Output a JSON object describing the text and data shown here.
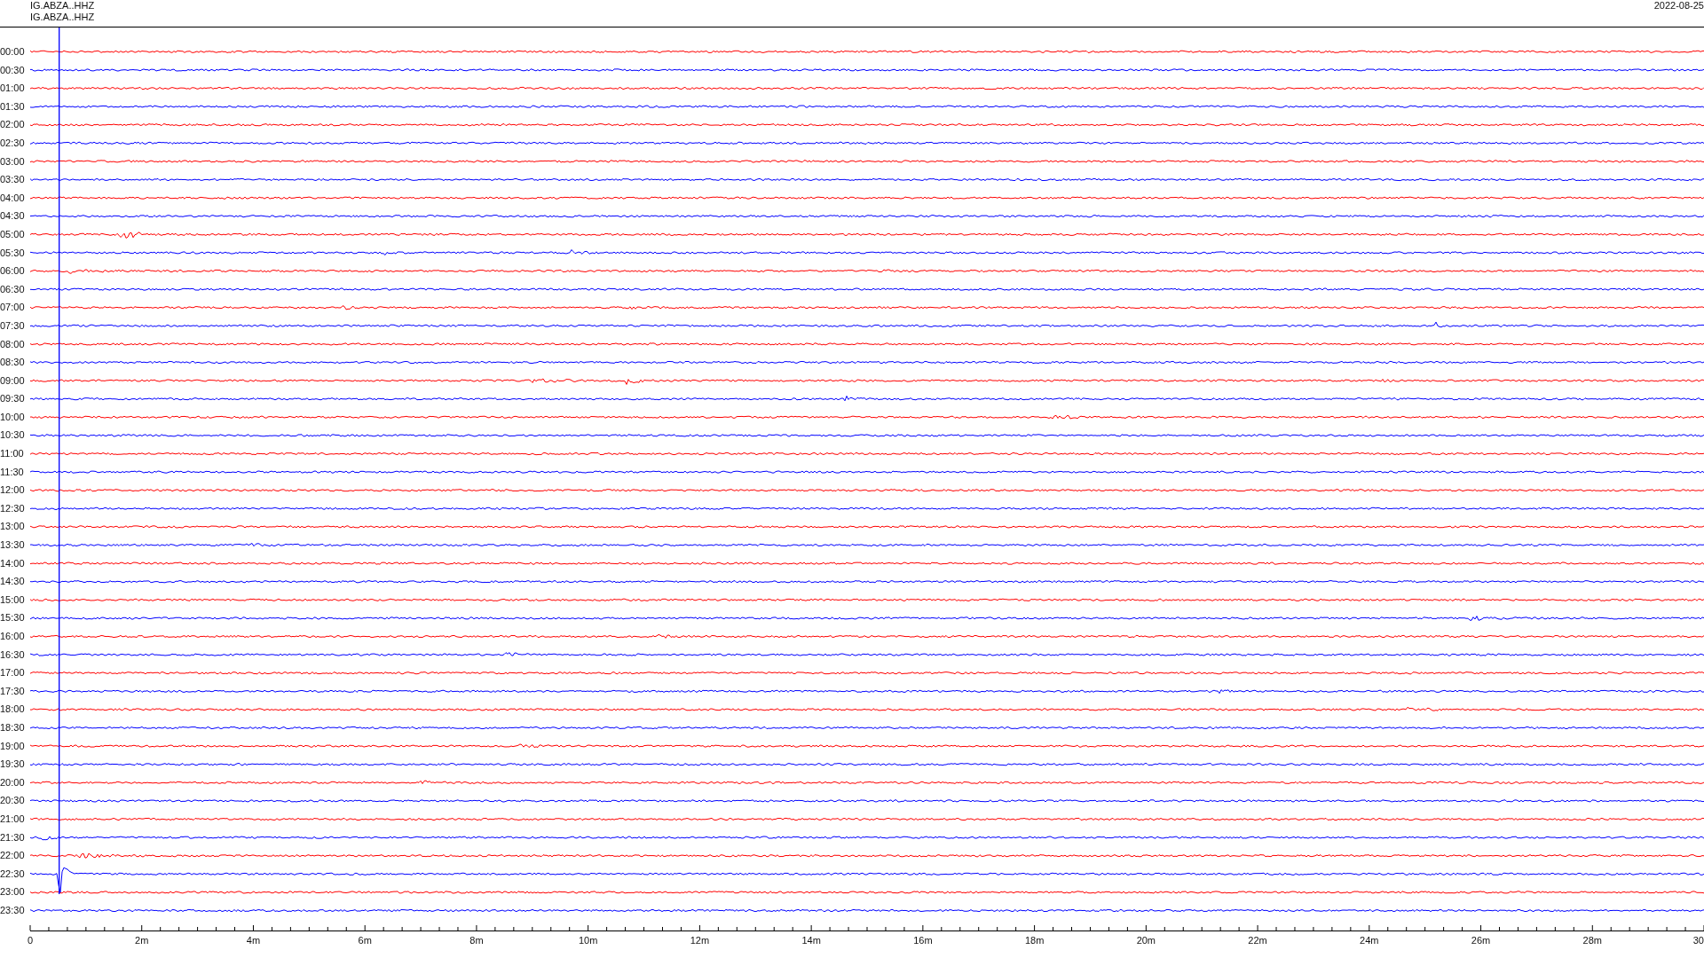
{
  "header": {
    "channel_lines": [
      "IG.ABZA..HHZ",
      "IG.ABZA..HHZ"
    ],
    "date": "2022-08-25"
  },
  "rows": [
    {
      "time": "00:00",
      "color": "#ff0000"
    },
    {
      "time": "00:30",
      "color": "#0000ff"
    },
    {
      "time": "01:00",
      "color": "#ff0000"
    },
    {
      "time": "01:30",
      "color": "#0000ff"
    },
    {
      "time": "02:00",
      "color": "#ff0000"
    },
    {
      "time": "02:30",
      "color": "#0000ff"
    },
    {
      "time": "03:00",
      "color": "#ff0000"
    },
    {
      "time": "03:30",
      "color": "#0000ff"
    },
    {
      "time": "04:00",
      "color": "#ff0000"
    },
    {
      "time": "04:30",
      "color": "#0000ff"
    },
    {
      "time": "05:00",
      "color": "#ff0000"
    },
    {
      "time": "05:30",
      "color": "#0000ff"
    },
    {
      "time": "06:00",
      "color": "#ff0000"
    },
    {
      "time": "06:30",
      "color": "#0000ff"
    },
    {
      "time": "07:00",
      "color": "#ff0000"
    },
    {
      "time": "07:30",
      "color": "#0000ff"
    },
    {
      "time": "08:00",
      "color": "#ff0000"
    },
    {
      "time": "08:30",
      "color": "#0000ff"
    },
    {
      "time": "09:00",
      "color": "#ff0000"
    },
    {
      "time": "09:30",
      "color": "#0000ff"
    },
    {
      "time": "10:00",
      "color": "#ff0000"
    },
    {
      "time": "10:30",
      "color": "#0000ff"
    },
    {
      "time": "11:00",
      "color": "#ff0000"
    },
    {
      "time": "11:30",
      "color": "#0000ff"
    },
    {
      "time": "12:00",
      "color": "#ff0000"
    },
    {
      "time": "12:30",
      "color": "#0000ff"
    },
    {
      "time": "13:00",
      "color": "#ff0000"
    },
    {
      "time": "13:30",
      "color": "#0000ff"
    },
    {
      "time": "14:00",
      "color": "#ff0000"
    },
    {
      "time": "14:30",
      "color": "#0000ff"
    },
    {
      "time": "15:00",
      "color": "#ff0000"
    },
    {
      "time": "15:30",
      "color": "#0000ff"
    },
    {
      "time": "16:00",
      "color": "#ff0000"
    },
    {
      "time": "16:30",
      "color": "#0000ff"
    },
    {
      "time": "17:00",
      "color": "#ff0000"
    },
    {
      "time": "17:30",
      "color": "#0000ff"
    },
    {
      "time": "18:00",
      "color": "#ff0000"
    },
    {
      "time": "18:30",
      "color": "#0000ff"
    },
    {
      "time": "19:00",
      "color": "#ff0000"
    },
    {
      "time": "19:30",
      "color": "#0000ff"
    },
    {
      "time": "20:00",
      "color": "#ff0000"
    },
    {
      "time": "20:30",
      "color": "#0000ff"
    },
    {
      "time": "21:00",
      "color": "#ff0000"
    },
    {
      "time": "21:30",
      "color": "#0000ff"
    },
    {
      "time": "22:00",
      "color": "#ff0000"
    },
    {
      "time": "22:30",
      "color": "#0000ff"
    },
    {
      "time": "23:00",
      "color": "#ff0000"
    },
    {
      "time": "23:30",
      "color": "#0000ff"
    }
  ],
  "x_axis": {
    "labels": [
      "0",
      "2m",
      "4m",
      "6m",
      "8m",
      "10m",
      "12m",
      "14m",
      "16m",
      "18m",
      "20m",
      "22m",
      "24m",
      "26m",
      "28m",
      "30"
    ]
  }
}
